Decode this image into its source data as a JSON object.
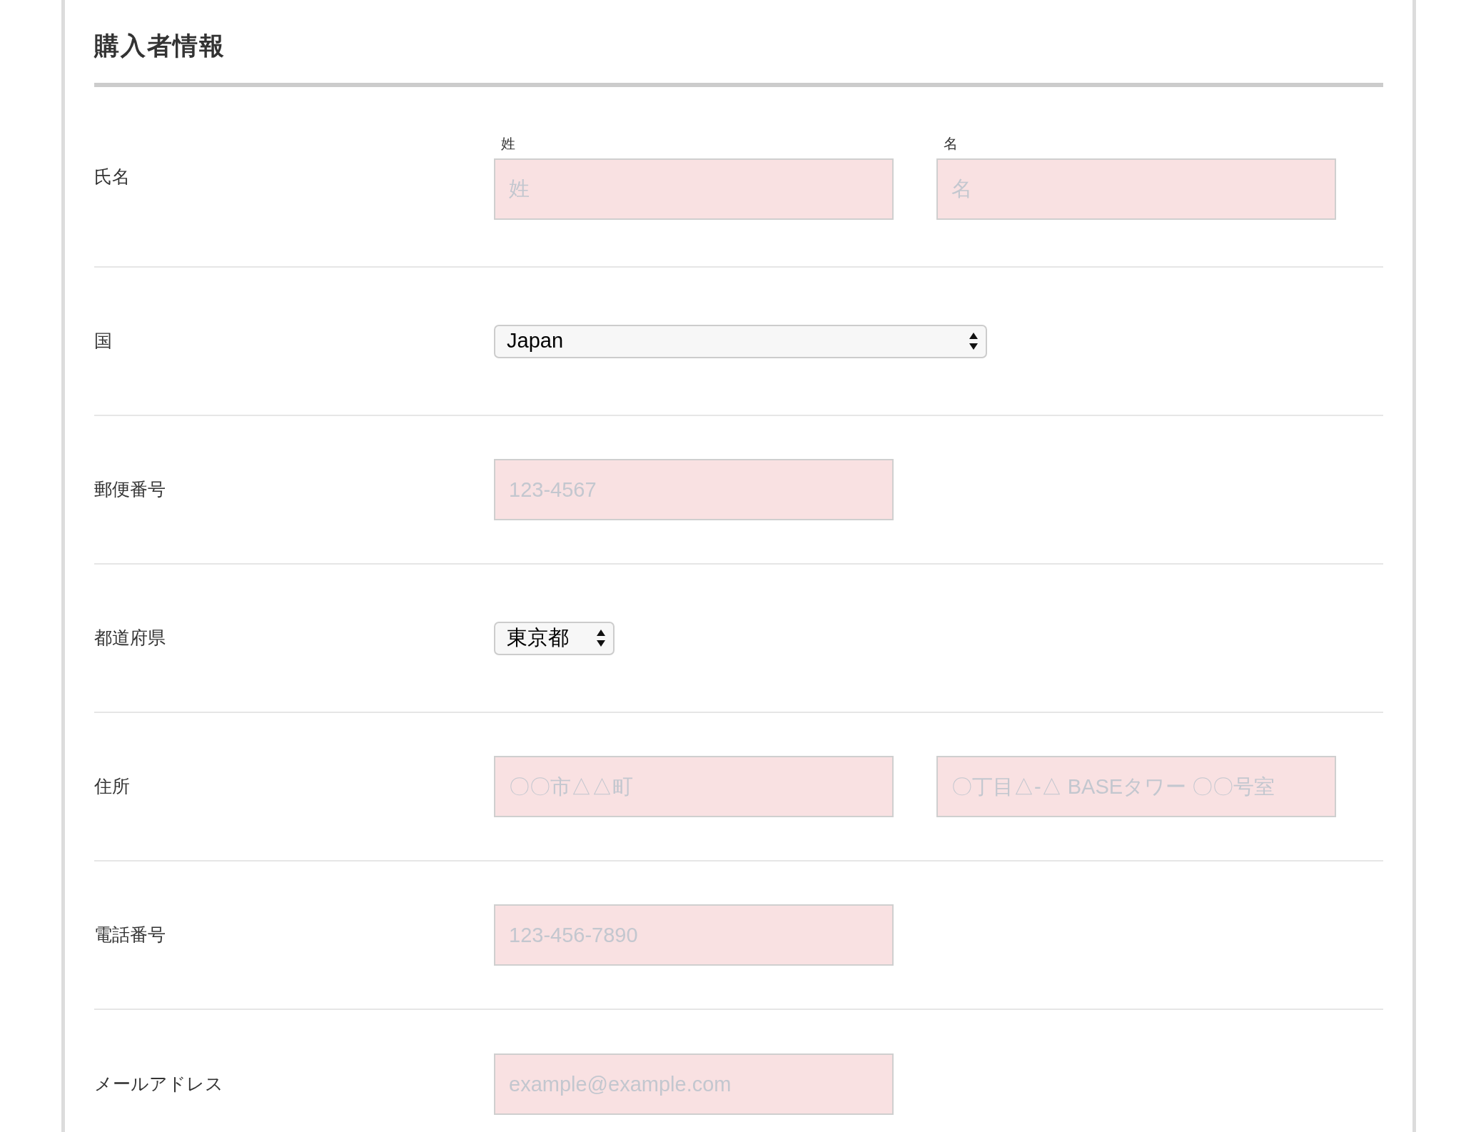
{
  "heading": "購入者情報",
  "rows": [
    {
      "label": "氏名",
      "kind": "text",
      "inputs": [
        {
          "sublabel": "姓",
          "placeholder": "姓"
        },
        {
          "sublabel": "名",
          "placeholder": "名"
        }
      ]
    },
    {
      "label": "国",
      "kind": "dropdown",
      "value": "Japan"
    },
    {
      "label": "郵便番号",
      "kind": "text",
      "inputs": [
        {
          "placeholder": "123-4567"
        }
      ]
    },
    {
      "label": "都道府県",
      "kind": "compact-dropdown",
      "value": "東京都"
    },
    {
      "label": "住所",
      "kind": "text",
      "inputs": [
        {
          "placeholder": "〇〇市△△町"
        },
        {
          "placeholder": "〇丁目△-△ BASEタワー 〇〇号室"
        }
      ]
    },
    {
      "label": "電話番号",
      "kind": "text",
      "inputs": [
        {
          "placeholder": "123-456-7890"
        }
      ]
    },
    {
      "label": "メールアドレス",
      "kind": "text",
      "inputs": [
        {
          "placeholder": "example@example.com"
        }
      ]
    }
  ]
}
